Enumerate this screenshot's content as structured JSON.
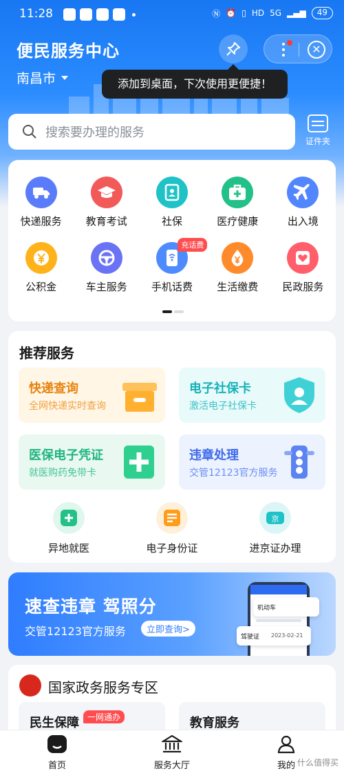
{
  "status_bar": {
    "time": "11:28",
    "network": "5G",
    "battery": "49",
    "hd_label": "HD"
  },
  "header": {
    "title": "便民服务中心",
    "city": "南昌市",
    "tooltip": "添加到桌面，下次使用更便捷！",
    "icons": [
      "pin-icon",
      "more-icon",
      "close-icon"
    ]
  },
  "search": {
    "placeholder": "搜索要办理的服务",
    "cert_label": "证件夹"
  },
  "services": [
    {
      "label": "快递服务",
      "icon": "truck-icon",
      "color": "#5b7cfa"
    },
    {
      "label": "教育考试",
      "icon": "graduation-cap-icon",
      "color": "#f25a5a"
    },
    {
      "label": "社保",
      "icon": "id-badge-icon",
      "color": "#1fc2c7"
    },
    {
      "label": "医疗健康",
      "icon": "medical-kit-icon",
      "color": "#23c08a"
    },
    {
      "label": "出入境",
      "icon": "airplane-icon",
      "color": "#5186ff"
    },
    {
      "label": "公积金",
      "icon": "yuan-coin-icon",
      "color": "#ffb21a"
    },
    {
      "label": "车主服务",
      "icon": "steering-wheel-icon",
      "color": "#6b73f5"
    },
    {
      "label": "手机话费",
      "icon": "phone-icon",
      "color": "#4d8bff",
      "badge": "充话费"
    },
    {
      "label": "生活缴费",
      "icon": "drop-yuan-icon",
      "color": "#ff8a2b"
    },
    {
      "label": "民政服务",
      "icon": "heart-icon",
      "color": "#ff5e6a"
    }
  ],
  "recommended": {
    "title": "推荐服务",
    "tiles": [
      {
        "title": "快递查询",
        "subtitle": "全网快递实时查询",
        "title_color": "#e8820c",
        "sub_color": "#f0a040",
        "bg": "#fff6e6",
        "icon": "package-icon"
      },
      {
        "title": "电子社保卡",
        "subtitle": "激活电子社保卡",
        "title_color": "#16b2b8",
        "sub_color": "#3fc1c6",
        "bg": "#e9fafa",
        "icon": "shield-person-icon"
      },
      {
        "title": "医保电子凭证",
        "subtitle": "就医购药免带卡",
        "title_color": "#1fb57e",
        "sub_color": "#43c492",
        "bg": "#e9f9f1",
        "icon": "medical-cross-icon"
      },
      {
        "title": "违章处理",
        "subtitle": "交管12123官方服务",
        "title_color": "#3d6bea",
        "sub_color": "#6a8ff0",
        "bg": "#edf2ff",
        "icon": "traffic-light-icon"
      }
    ],
    "mini": [
      {
        "label": "异地就医",
        "icon": "hospital-plus-icon",
        "color": "#23c08a"
      },
      {
        "label": "电子身份证",
        "icon": "id-card-icon",
        "color": "#ff9c1a"
      },
      {
        "label": "进京证办理",
        "icon": "beijing-pass-icon",
        "color": "#1fc2c7"
      }
    ]
  },
  "banner": {
    "title": "速查违章 驾照分",
    "subtitle": "交管12123官方服务",
    "button": "立即查询>",
    "phone_labels": {
      "car": "机动车",
      "license": "驾驶证",
      "date": "2023-02-21"
    }
  },
  "gov": {
    "title": "国家政务服务专区",
    "tiles": [
      {
        "title": "民生保障",
        "badge": "一网通办"
      },
      {
        "title": "教育服务"
      }
    ]
  },
  "tabbar": {
    "items": [
      {
        "label": "首页",
        "icon": "home-icon"
      },
      {
        "label": "服务大厅",
        "icon": "hall-icon"
      },
      {
        "label": "我的",
        "icon": "person-icon"
      }
    ]
  },
  "watermark": "什么值得买"
}
